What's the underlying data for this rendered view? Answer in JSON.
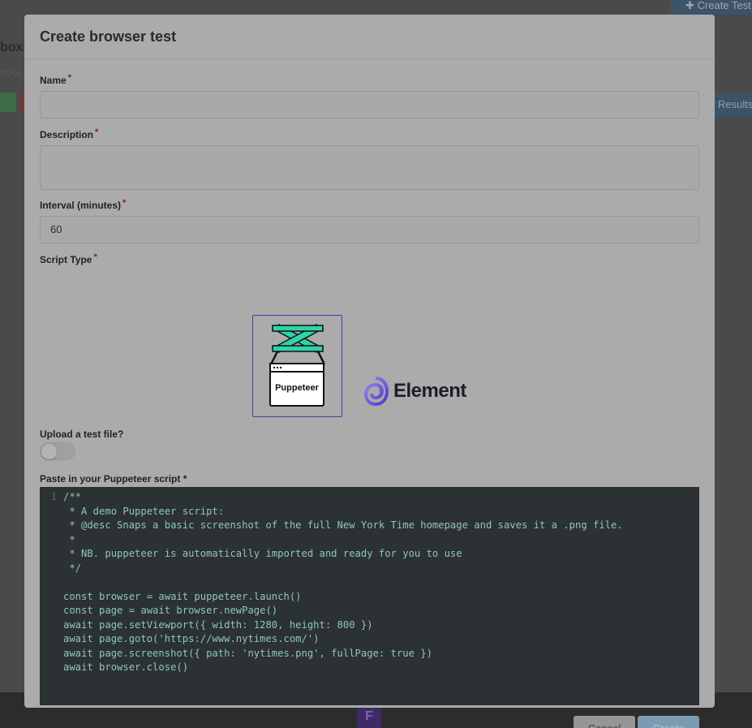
{
  "background": {
    "top_button_label": "Create Test",
    "title": "boxR",
    "subtitle": "oxRu",
    "results_button_label": "w Results",
    "footer_logo": "F"
  },
  "modal": {
    "title": "Create browser test",
    "fields": {
      "name": {
        "label": "Name",
        "required_mark": "*",
        "value": ""
      },
      "description": {
        "label": "Description",
        "required_mark": "*",
        "value": ""
      },
      "interval": {
        "label": "Interval (minutes)",
        "required_mark": "*",
        "value": "60"
      }
    },
    "script_type": {
      "label": "Script Type",
      "required_mark": "*",
      "options": [
        {
          "name": "Puppeteer",
          "selected": true
        },
        {
          "name": "Element",
          "selected": false
        }
      ]
    },
    "upload": {
      "label": "Upload a test file?",
      "enabled": false
    },
    "script": {
      "label": "Paste in your Puppeteer script *",
      "line_number": "1",
      "lines": [
        "/**",
        " * A demo Puppeteer script:",
        " * @desc Snaps a basic screenshot of the full New York Time homepage and saves it a .png file.",
        " *",
        " * NB. puppeteer is automatically imported and ready for you to use",
        " */",
        "",
        "const browser = await puppeteer.launch()",
        "const page = await browser.newPage()",
        "await page.setViewport({ width: 1280, height: 800 })",
        "await page.goto('https://www.nytimes.com/')",
        "await page.screenshot({ path: 'nytimes.png', fullPage: true })",
        "await browser.close()"
      ]
    },
    "buttons": {
      "cancel": "Cancel",
      "create": "Create"
    }
  }
}
